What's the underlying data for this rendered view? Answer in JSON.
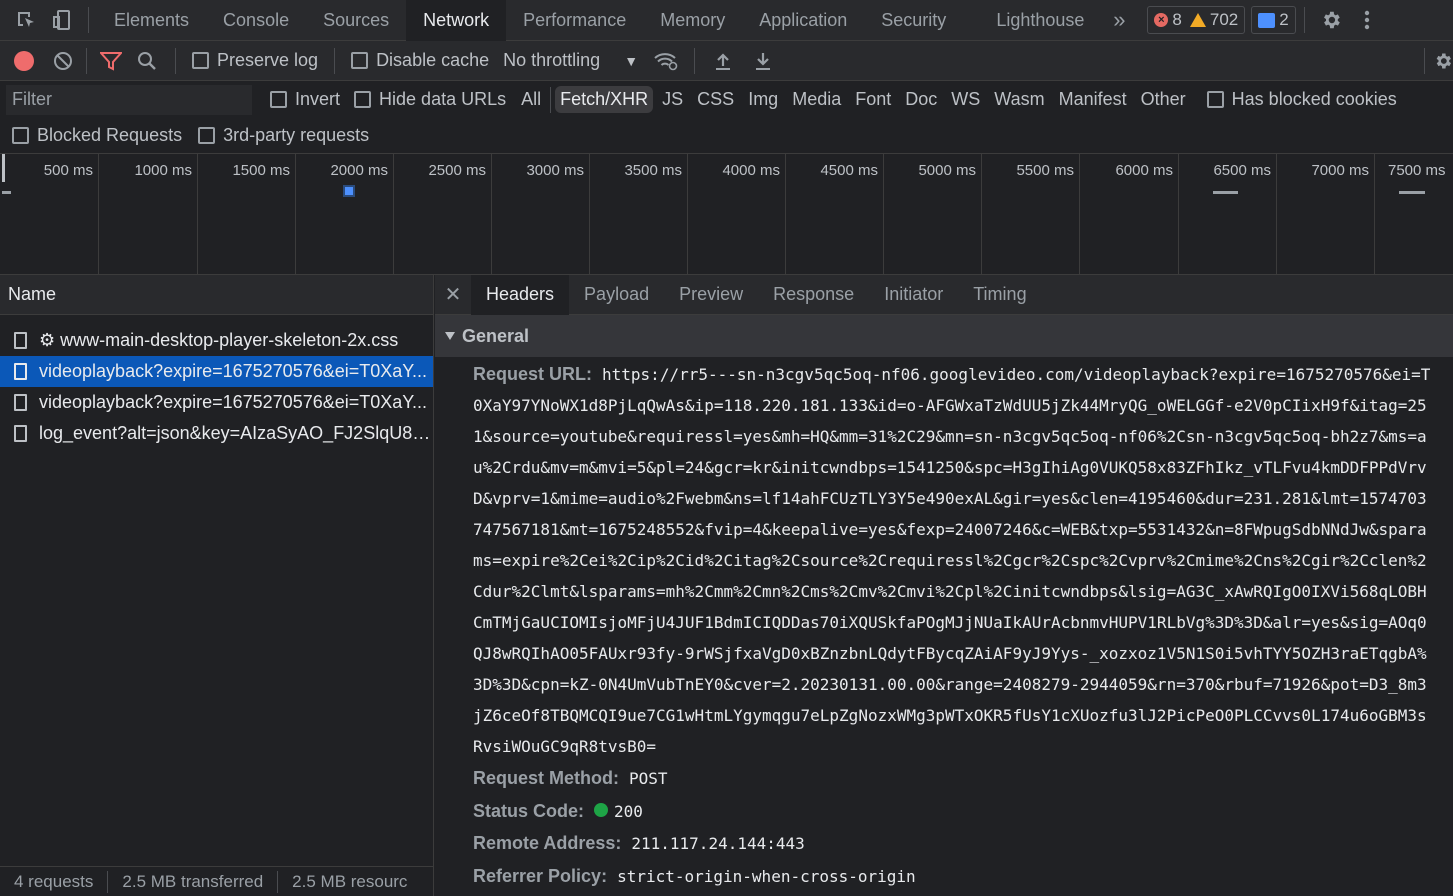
{
  "tabs": [
    "Elements",
    "Console",
    "Sources",
    "Network",
    "Performance",
    "Memory",
    "Application",
    "Security",
    "Lighthouse"
  ],
  "active_tab": "Network",
  "counters": {
    "errors": "8",
    "warnings": "702",
    "messages": "2"
  },
  "toolbar": {
    "preserve_log": "Preserve log",
    "disable_cache": "Disable cache",
    "throttling": "No throttling"
  },
  "filter": {
    "placeholder": "Filter",
    "invert": "Invert",
    "hide_data_urls": "Hide data URLs",
    "types": [
      "All",
      "Fetch/XHR",
      "JS",
      "CSS",
      "Img",
      "Media",
      "Font",
      "Doc",
      "WS",
      "Wasm",
      "Manifest",
      "Other"
    ],
    "selected_type": "Fetch/XHR",
    "has_blocked_cookies": "Has blocked cookies",
    "blocked_requests": "Blocked Requests",
    "third_party": "3rd-party requests"
  },
  "timeline": {
    "ticks": [
      "500 ms",
      "1000 ms",
      "1500 ms",
      "2000 ms",
      "2500 ms",
      "3000 ms",
      "3500 ms",
      "4000 ms",
      "4500 ms",
      "5000 ms",
      "5500 ms",
      "6000 ms",
      "6500 ms",
      "7000 ms",
      "7500 ms"
    ]
  },
  "requests": {
    "header": "Name",
    "items": [
      {
        "name": "⚙ www-main-desktop-player-skeleton-2x.css",
        "selected": false
      },
      {
        "name": "videoplayback?expire=1675270576&ei=T0XaY...",
        "selected": true
      },
      {
        "name": "videoplayback?expire=1675270576&ei=T0XaY...",
        "selected": false
      },
      {
        "name": "log_event?alt=json&key=AIzaSyAO_FJ2SlqU8Q...",
        "selected": false
      }
    ]
  },
  "status": {
    "requests": "4 requests",
    "transferred": "2.5 MB transferred",
    "resources": "2.5 MB resourc"
  },
  "detail_tabs": [
    "Headers",
    "Payload",
    "Preview",
    "Response",
    "Initiator",
    "Timing"
  ],
  "active_detail_tab": "Headers",
  "general": {
    "title": "General",
    "request_url_label": "Request URL:",
    "request_url_lines": [
      "https://rr5---sn-n3cgv5qc5oq-nf06.googlevideo.com/videoplayback?expire=1675270576&ei=T",
      "0XaY97YNoWX1d8PjLqQwAs&ip=118.220.181.133&id=o-AFGWxaTzWdUU5jZk44MryQG_oWELGGf-e2V0pCIixH9f&itag=25",
      "1&source=youtube&requiressl=yes&mh=HQ&mm=31%2C29&mn=sn-n3cgv5qc5oq-nf06%2Csn-n3cgv5qc5oq-bh2z7&ms=a",
      "u%2Crdu&mv=m&mvi=5&pl=24&gcr=kr&initcwndbps=1541250&spc=H3gIhiAg0VUKQ58x83ZFhIkz_vTLFvu4kmDDFPPdVrv",
      "D&vprv=1&mime=audio%2Fwebm&ns=lf14ahFCUzTLY3Y5e490exAL&gir=yes&clen=4195460&dur=231.281&lmt=1574703",
      "747567181&mt=1675248552&fvip=4&keepalive=yes&fexp=24007246&c=WEB&txp=5531432&n=8FWpugSdbNNdJw&spara",
      "ms=expire%2Cei%2Cip%2Cid%2Citag%2Csource%2Crequiressl%2Cgcr%2Cspc%2Cvprv%2Cmime%2Cns%2Cgir%2Cclen%2",
      "Cdur%2Clmt&lsparams=mh%2Cmm%2Cmn%2Cms%2Cmv%2Cmvi%2Cpl%2Cinitcwndbps&lsig=AG3C_xAwRQIgO0IXVi568qLOBH",
      "CmTMjGaUCIOMIsjoMFjU4JUF1BdmICIQDDas70iXQUSkfaPOgMJjNUaIkAUrAcbnmvHUPV1RLbVg%3D%3D&alr=yes&sig=AOq0",
      "QJ8wRQIhAO05FAUxr93fy-9rWSjfxaVgD0xBZnzbnLQdytFBycqZAiAF9yJ9Yys-_xozxoz1V5N1S0i5vhTYY5OZH3raETqgbA%",
      "3D%3D&cpn=kZ-0N4UmVubTnEY0&cver=2.20230131.00.00&range=2408279-2944059&rn=370&rbuf=71926&pot=D3_8m3",
      "jZ6ceOf8TBQMCQI9ue7CG1wHtmLYgymqgu7eLpZgNozxWMg3pWTxOKR5fUsY1cXUozfu3lJ2PicPeO0PLCCvvs0L174u6oGBM3s",
      "RvsiWOuGC9qR8tvsB0="
    ],
    "request_method_label": "Request Method:",
    "request_method": "POST",
    "status_code_label": "Status Code:",
    "status_code": "200",
    "remote_address_label": "Remote Address:",
    "remote_address": "211.117.24.144:443",
    "referrer_policy_label": "Referrer Policy:",
    "referrer_policy": "strict-origin-when-cross-origin"
  }
}
